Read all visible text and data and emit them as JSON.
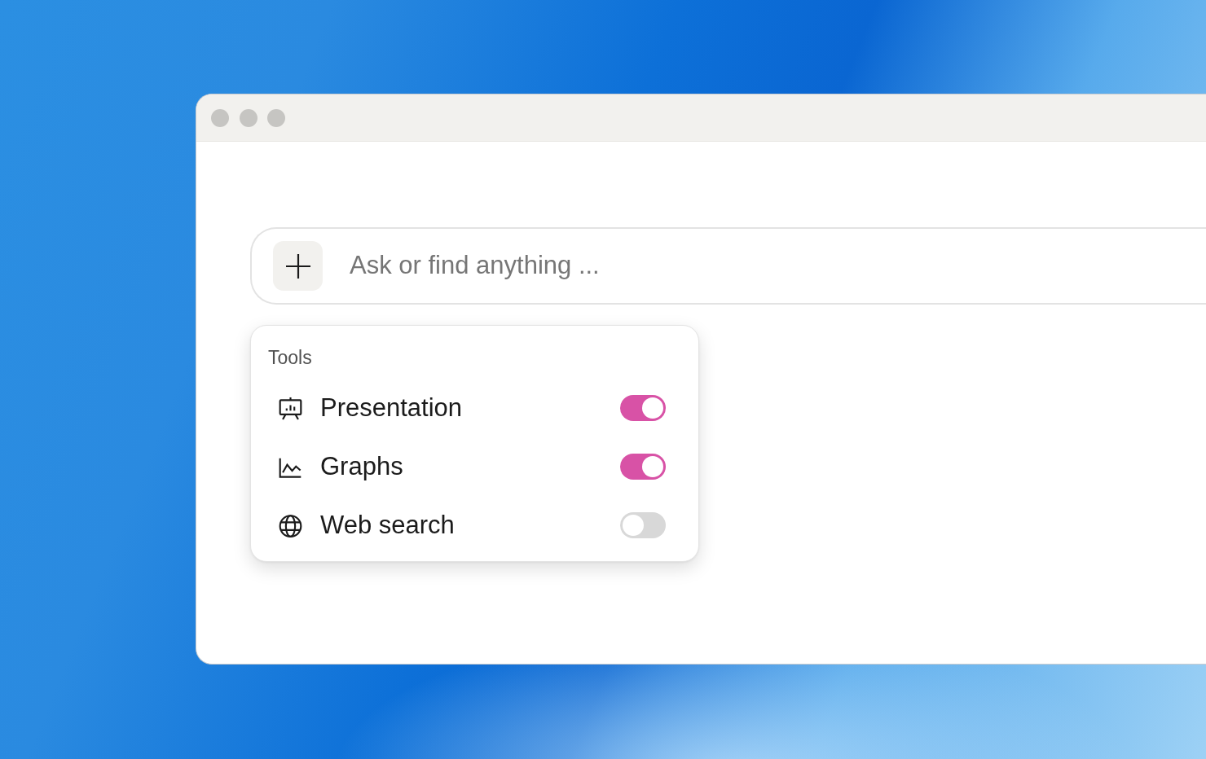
{
  "search": {
    "placeholder": "Ask or find anything ..."
  },
  "tools_menu": {
    "title": "Tools",
    "items": [
      {
        "label": "Presentation",
        "on": true
      },
      {
        "label": "Graphs",
        "on": true
      },
      {
        "label": "Web search",
        "on": false
      }
    ]
  }
}
